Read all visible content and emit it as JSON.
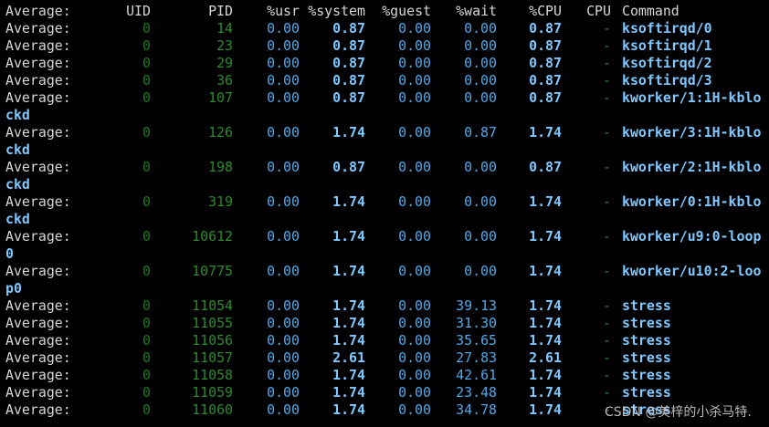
{
  "header": {
    "label": "Average:",
    "uid": "UID",
    "pid": "PID",
    "usr": "%usr",
    "system": "%system",
    "guest": "%guest",
    "wait": "%wait",
    "cpu_pct": "%CPU",
    "cpu": "CPU",
    "command": "Command"
  },
  "rows": [
    {
      "label": "Average:",
      "uid": "0",
      "pid": "14",
      "usr": "0.00",
      "system": "0.87",
      "guest": "0.00",
      "wait": "0.00",
      "cpu_pct": "0.87",
      "cpu": "-",
      "command": "ksoftirqd/0",
      "wrap": ""
    },
    {
      "label": "Average:",
      "uid": "0",
      "pid": "23",
      "usr": "0.00",
      "system": "0.87",
      "guest": "0.00",
      "wait": "0.00",
      "cpu_pct": "0.87",
      "cpu": "-",
      "command": "ksoftirqd/1",
      "wrap": ""
    },
    {
      "label": "Average:",
      "uid": "0",
      "pid": "29",
      "usr": "0.00",
      "system": "0.87",
      "guest": "0.00",
      "wait": "0.00",
      "cpu_pct": "0.87",
      "cpu": "-",
      "command": "ksoftirqd/2",
      "wrap": ""
    },
    {
      "label": "Average:",
      "uid": "0",
      "pid": "36",
      "usr": "0.00",
      "system": "0.87",
      "guest": "0.00",
      "wait": "0.00",
      "cpu_pct": "0.87",
      "cpu": "-",
      "command": "ksoftirqd/3",
      "wrap": ""
    },
    {
      "label": "Average:",
      "uid": "0",
      "pid": "107",
      "usr": "0.00",
      "system": "0.87",
      "guest": "0.00",
      "wait": "0.00",
      "cpu_pct": "0.87",
      "cpu": "-",
      "command": "kworker/1:1H-kblo",
      "wrap": "ckd"
    },
    {
      "label": "Average:",
      "uid": "0",
      "pid": "126",
      "usr": "0.00",
      "system": "1.74",
      "guest": "0.00",
      "wait": "0.87",
      "cpu_pct": "1.74",
      "cpu": "-",
      "command": "kworker/3:1H-kblo",
      "wrap": "ckd"
    },
    {
      "label": "Average:",
      "uid": "0",
      "pid": "198",
      "usr": "0.00",
      "system": "0.87",
      "guest": "0.00",
      "wait": "0.00",
      "cpu_pct": "0.87",
      "cpu": "-",
      "command": "kworker/2:1H-kblo",
      "wrap": "ckd"
    },
    {
      "label": "Average:",
      "uid": "0",
      "pid": "319",
      "usr": "0.00",
      "system": "1.74",
      "guest": "0.00",
      "wait": "0.00",
      "cpu_pct": "1.74",
      "cpu": "-",
      "command": "kworker/0:1H-kblo",
      "wrap": "ckd"
    },
    {
      "label": "Average:",
      "uid": "0",
      "pid": "10612",
      "usr": "0.00",
      "system": "1.74",
      "guest": "0.00",
      "wait": "0.00",
      "cpu_pct": "1.74",
      "cpu": "-",
      "command": "kworker/u9:0-loop",
      "wrap": "0"
    },
    {
      "label": "Average:",
      "uid": "0",
      "pid": "10775",
      "usr": "0.00",
      "system": "1.74",
      "guest": "0.00",
      "wait": "0.00",
      "cpu_pct": "1.74",
      "cpu": "-",
      "command": "kworker/u10:2-loo",
      "wrap": "p0"
    },
    {
      "label": "Average:",
      "uid": "0",
      "pid": "11054",
      "usr": "0.00",
      "system": "1.74",
      "guest": "0.00",
      "wait": "39.13",
      "cpu_pct": "1.74",
      "cpu": "-",
      "command": "stress",
      "wrap": ""
    },
    {
      "label": "Average:",
      "uid": "0",
      "pid": "11055",
      "usr": "0.00",
      "system": "1.74",
      "guest": "0.00",
      "wait": "31.30",
      "cpu_pct": "1.74",
      "cpu": "-",
      "command": "stress",
      "wrap": ""
    },
    {
      "label": "Average:",
      "uid": "0",
      "pid": "11056",
      "usr": "0.00",
      "system": "1.74",
      "guest": "0.00",
      "wait": "35.65",
      "cpu_pct": "1.74",
      "cpu": "-",
      "command": "stress",
      "wrap": ""
    },
    {
      "label": "Average:",
      "uid": "0",
      "pid": "11057",
      "usr": "0.00",
      "system": "2.61",
      "guest": "0.00",
      "wait": "27.83",
      "cpu_pct": "2.61",
      "cpu": "-",
      "command": "stress",
      "wrap": ""
    },
    {
      "label": "Average:",
      "uid": "0",
      "pid": "11058",
      "usr": "0.00",
      "system": "1.74",
      "guest": "0.00",
      "wait": "42.61",
      "cpu_pct": "1.74",
      "cpu": "-",
      "command": "stress",
      "wrap": ""
    },
    {
      "label": "Average:",
      "uid": "0",
      "pid": "11059",
      "usr": "0.00",
      "system": "1.74",
      "guest": "0.00",
      "wait": "23.48",
      "cpu_pct": "1.74",
      "cpu": "-",
      "command": "stress",
      "wrap": ""
    },
    {
      "label": "Average:",
      "uid": "0",
      "pid": "11060",
      "usr": "0.00",
      "system": "1.74",
      "guest": "0.00",
      "wait": "34.78",
      "cpu_pct": "1.74",
      "cpu": "-",
      "command": "stress",
      "wrap": ""
    }
  ],
  "watermark": "CSDN @美梓的小杀马特.",
  "colors": {
    "background": "#000000",
    "text": "#d6d6d6",
    "dim_green": "#2d8a2d",
    "blue": "#4fa8e8",
    "bold_blue": "#7ec8ff"
  }
}
